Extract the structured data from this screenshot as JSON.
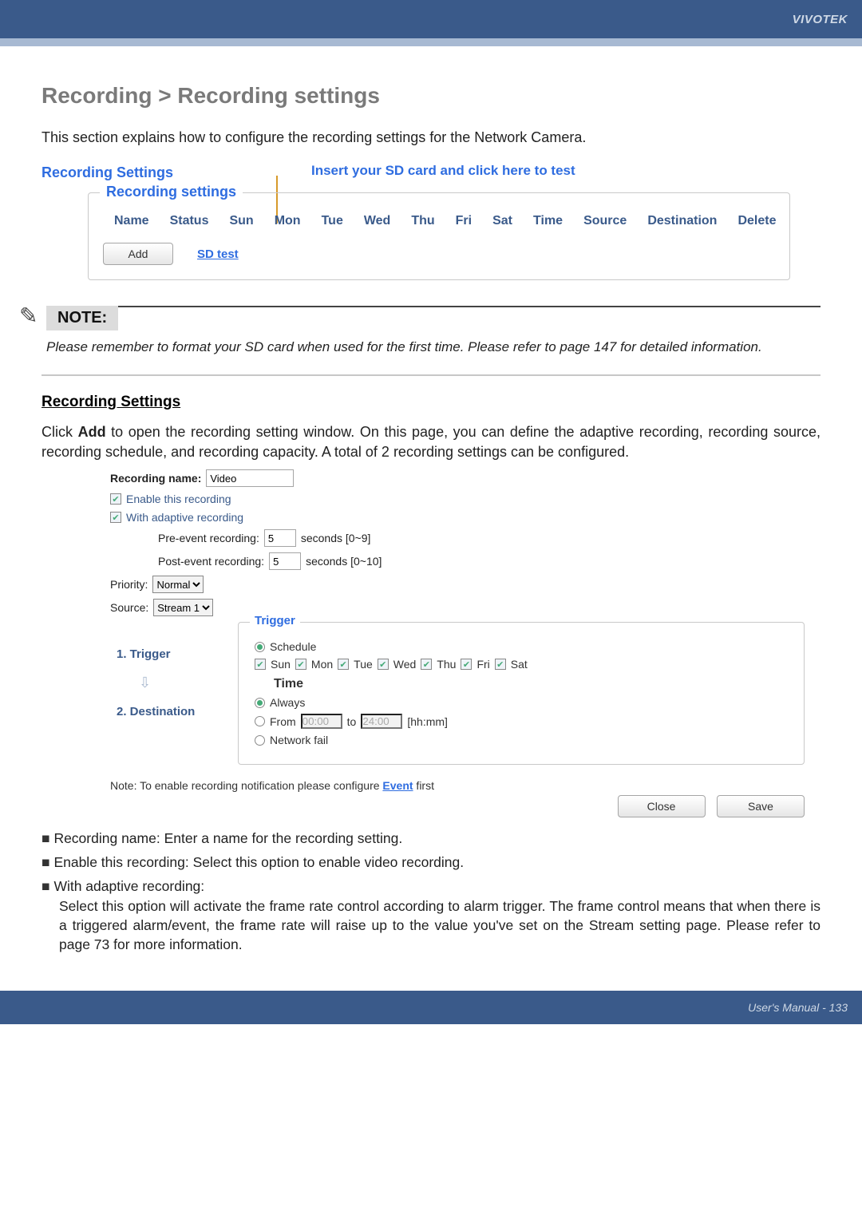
{
  "brand": "VIVOTEK",
  "title": "Recording > Recording settings",
  "intro": "This section explains how to configure the recording settings for the Network Camera.",
  "rs_heading": "Recording Settings",
  "insert_callout": "Insert your SD card and click here to test",
  "fs_legend": "Recording settings",
  "cols": {
    "name": "Name",
    "status": "Status",
    "sun": "Sun",
    "mon": "Mon",
    "tue": "Tue",
    "wed": "Wed",
    "thu": "Thu",
    "fri": "Fri",
    "sat": "Sat",
    "time": "Time",
    "source": "Source",
    "destination": "Destination",
    "delete": "Delete"
  },
  "add_btn": "Add",
  "sd_test": "SD test",
  "note_label": "NOTE:",
  "note_text": "Please remember to format your SD card when used for the first time. Please refer to page 147 for detailed information.",
  "rs_under": "Recording Settings",
  "add_para_1": "Click ",
  "add_bold": "Add",
  "add_para_2": " to open the recording setting window. On this page, you can define the adaptive recording, recording source, recording schedule, and recording capacity. A total of 2 recording settings can be configured.",
  "dlg": {
    "name_lbl": "Recording name:",
    "name_val": "Video",
    "enable": "Enable this recording",
    "adaptive": "With adaptive recording",
    "pre_lbl": "Pre-event recording:",
    "pre_val": "5",
    "pre_unit": "seconds [0~9]",
    "post_lbl": "Post-event recording:",
    "post_val": "5",
    "post_unit": "seconds [0~10]",
    "prio_lbl": "Priority:",
    "prio_val": "Normal",
    "src_lbl": "Source:",
    "src_val": "Stream 1",
    "step1": "1.  Trigger",
    "step2": "2.  Destination",
    "trig_legend": "Trigger",
    "schedule": "Schedule",
    "days": {
      "sun": "Sun",
      "mon": "Mon",
      "tue": "Tue",
      "wed": "Wed",
      "thu": "Thu",
      "fri": "Fri",
      "sat": "Sat"
    },
    "time": "Time",
    "always": "Always",
    "from": "From",
    "from_v": "00:00",
    "to": "to",
    "to_v": "24:00",
    "hhmm": "[hh:mm]",
    "netfail": "Network fail",
    "note": "Note: To enable recording notification please configure ",
    "evt": "Event",
    "note2": " first",
    "close": "Close",
    "save": "Save"
  },
  "bul1": "Recording name: Enter a name for the recording setting.",
  "bul2": "Enable this recording: Select this option to enable video recording.",
  "bul3_head": "With adaptive recording:",
  "bul3_body": "Select this option will activate the frame rate control according to alarm trigger. The frame control means that when there is a triggered alarm/event, the frame rate will raise up to the value you've set on the Stream setting page. Please refer to page 73 for more information.",
  "footer": "User's Manual - 133"
}
